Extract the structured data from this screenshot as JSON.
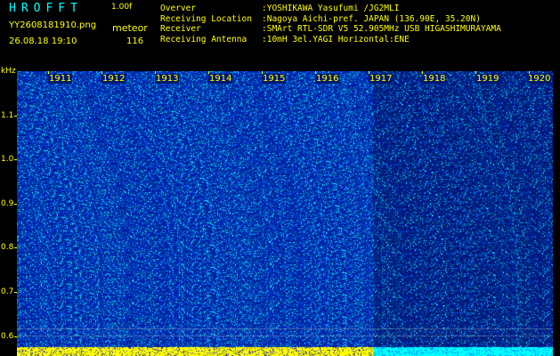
{
  "header": {
    "app_title": "HROFFT",
    "version": "1.00f",
    "file_name": "YY2608181910.png",
    "date_time": "26.08.18 19:10",
    "mode_label": "meteor",
    "count_value": "116"
  },
  "meta": [
    {
      "key": "Overver",
      "value": ":YOSHIKAWA Yasufumi /JG2MLI"
    },
    {
      "key": "Receiving Location",
      "value": ":Nagoya Aichi-pref. JAPAN (136.90E, 35.20N)"
    },
    {
      "key": "Receiver",
      "value": ":SMArt RTL-SDR V5 52.905MHz USB HIGASHIMURAYAMA"
    },
    {
      "key": "Receiving Antenna",
      "value": ":10mH 3el.YAGI Horizontal:ENE"
    }
  ],
  "freq_axis": {
    "unit": "kHz",
    "ticks": [
      "1.1",
      "1.0",
      "0.9",
      "0.8",
      "0.7",
      "0.6"
    ]
  },
  "time_axis": {
    "labels": [
      "1911",
      "1912",
      "1913",
      "1914",
      "1915",
      "1916",
      "1917",
      "1918",
      "1919",
      "1920"
    ]
  },
  "colors": {
    "background": "#000000",
    "label": "#ffff00",
    "title": "#00ffff",
    "spectrogram_base": "#062090",
    "noise_bright": "#00ffff",
    "bottom_band": "#ffff00"
  }
}
